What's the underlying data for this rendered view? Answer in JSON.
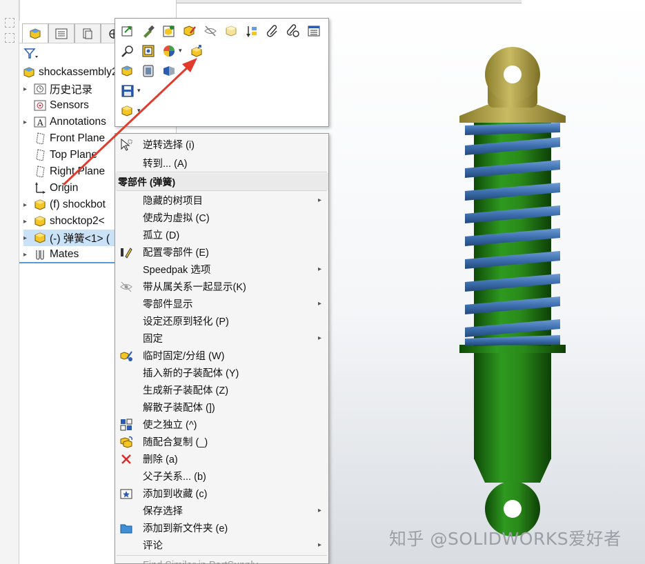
{
  "tree": {
    "root_label": "shockassembly2",
    "items": [
      {
        "label": "历史记录",
        "icon": "history-icon",
        "expandable": true
      },
      {
        "label": "Sensors",
        "icon": "sensor-icon",
        "expandable": false
      },
      {
        "label": "Annotations",
        "icon": "annotation-icon",
        "expandable": true
      },
      {
        "label": "Front Plane",
        "icon": "plane-icon",
        "expandable": false
      },
      {
        "label": "Top Plane",
        "icon": "plane-icon",
        "expandable": false
      },
      {
        "label": "Right Plane",
        "icon": "plane-icon",
        "expandable": false
      },
      {
        "label": "Origin",
        "icon": "origin-icon",
        "expandable": false
      },
      {
        "label": "(f) shockbot",
        "icon": "part-icon",
        "expandable": true
      },
      {
        "label": "shocktop2<",
        "icon": "part-icon",
        "expandable": true
      },
      {
        "label": "(-) 弹簧<1> (",
        "icon": "part-icon",
        "expandable": true,
        "selected": true
      },
      {
        "label": "Mates",
        "icon": "mates-icon",
        "expandable": true
      }
    ]
  },
  "toolbar": {
    "icons": [
      "open-part-icon",
      "edit-component-icon",
      "rebuild-icon",
      "appearance-part-icon",
      "hide-icon",
      "transparency-icon",
      "sort-icon",
      "paperclip-icon",
      "paperclip-link-icon",
      "table-icon",
      "zoom-to-selection-icon",
      "normal-to-icon",
      "appearance-icon",
      "move-component-icon",
      "component-properties-icon",
      "isolate-icon",
      "section-view-icon",
      "save-icon",
      "insert-component-icon"
    ]
  },
  "menu": {
    "items_top": [
      {
        "label": "逆转选择 (i)",
        "icon": "invert-select-icon"
      },
      {
        "label": "转到... (A)",
        "icon": ""
      }
    ],
    "section_header": "零部件 (弹簧)",
    "items": [
      {
        "label": "隐藏的树项目",
        "icon": "",
        "submenu": true
      },
      {
        "label": "使成为虚拟 (C)",
        "icon": "",
        "submenu": false
      },
      {
        "label": "孤立 (D)",
        "icon": "",
        "submenu": false
      },
      {
        "label": "配置零部件 (E)",
        "icon": "configure-icon",
        "submenu": false
      },
      {
        "label": "Speedpak 选项",
        "icon": "",
        "submenu": true
      },
      {
        "label": "带从属关系一起显示(K)",
        "icon": "show-with-dependents-icon",
        "submenu": false
      },
      {
        "label": "零部件显示",
        "icon": "",
        "submenu": true
      },
      {
        "label": "设定还原到轻化 (P)",
        "icon": "",
        "submenu": false
      },
      {
        "label": "固定",
        "icon": "",
        "submenu": true
      },
      {
        "label": "临时固定/分组 (W)",
        "icon": "temp-fix-icon",
        "submenu": false
      },
      {
        "label": "插入新的子装配体 (Y)",
        "icon": "",
        "submenu": false
      },
      {
        "label": "生成新子装配体 (Z)",
        "icon": "",
        "submenu": false
      },
      {
        "label": "解散子装配体 (])",
        "icon": "",
        "submenu": false
      },
      {
        "label": "使之独立 (^)",
        "icon": "make-independent-icon",
        "submenu": false
      },
      {
        "label": "随配合复制 (_)",
        "icon": "copy-with-mates-icon",
        "submenu": false
      },
      {
        "label": "删除 (a)",
        "icon": "delete-icon",
        "submenu": false
      },
      {
        "label": "父子关系... (b)",
        "icon": "",
        "submenu": false
      },
      {
        "label": "添加到收藏 (c)",
        "icon": "favorite-icon",
        "submenu": false
      },
      {
        "label": "保存选择",
        "icon": "",
        "submenu": true
      },
      {
        "label": "添加到新文件夹 (e)",
        "icon": "folder-icon",
        "submenu": false
      },
      {
        "label": "评论",
        "icon": "",
        "submenu": true
      },
      {
        "label": "Find Similar in PartSupply",
        "icon": "",
        "submenu": false,
        "disabled": true
      }
    ]
  },
  "watermark": "知乎 @SOLIDWORKS爱好者",
  "colors": {
    "spring": "#3d6fae",
    "body": "#1f7a12",
    "top_cap": "#b0a24a",
    "arrow": "#e23b2e",
    "selection": "#c9e2f8"
  }
}
